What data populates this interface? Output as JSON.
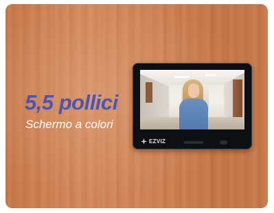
{
  "promo": {
    "headline": "5,5 pollici",
    "subline": "Schermo a colori",
    "headline_color": "#4a56b6"
  },
  "device": {
    "brand_label": "EZVIZ",
    "brand_icon": "ezviz-logo-icon"
  }
}
